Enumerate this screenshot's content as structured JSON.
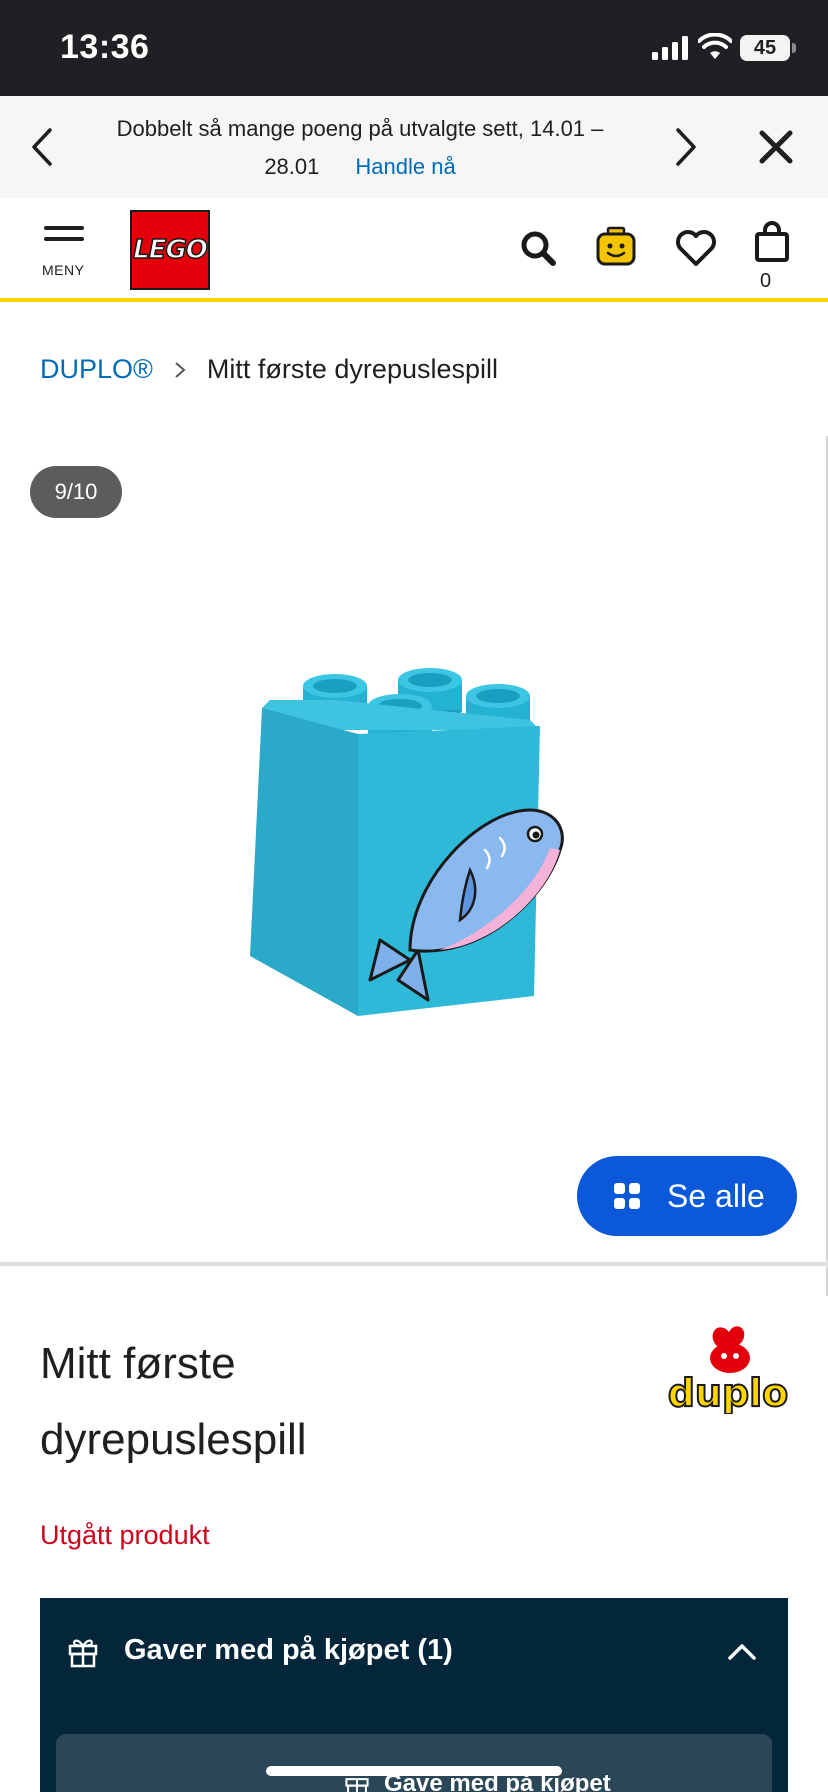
{
  "status_bar": {
    "time": "13:36",
    "battery": "45"
  },
  "promo_banner": {
    "text": "Dobbelt så mange poeng på utvalgte sett, 14.01 – 28.01",
    "link": "Handle nå"
  },
  "header": {
    "menu_label": "MENY",
    "logo_text": "LEGO",
    "cart_count": "0"
  },
  "breadcrumb": {
    "parent": "DUPLO®",
    "current": "Mitt første dyrepuslespill"
  },
  "gallery": {
    "counter": "9/10",
    "see_all_label": "Se alle"
  },
  "product": {
    "title_line1": "Mitt første",
    "title_line2": "dyrepuslespill",
    "brand_logo_text": "duplo",
    "status": "Utgått produkt"
  },
  "gifts": {
    "title": "Gaver med på kjøpet (1)",
    "card_label": "Gave med på kjøpet"
  },
  "colors": {
    "brand_red": "#e3000b",
    "accent_yellow": "#ffd500",
    "link_blue": "#006cb7",
    "button_blue": "#0b58d8",
    "retired_red": "#d0021b",
    "gift_panel": "#03263a"
  },
  "icons": [
    "chevron-left-icon",
    "chevron-right-icon",
    "close-icon",
    "hamburger-icon",
    "search-icon",
    "minifig-head-icon",
    "heart-icon",
    "shopping-bag-icon",
    "grid-icon",
    "gift-icon",
    "chevron-up-icon"
  ]
}
